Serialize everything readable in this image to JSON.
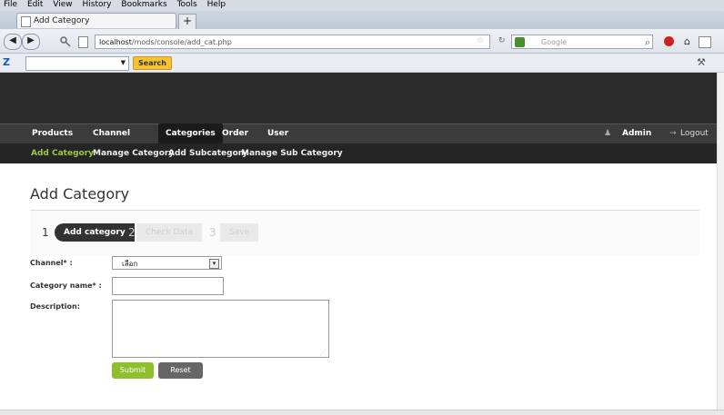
{
  "menubar": [
    "File",
    "Edit",
    "View",
    "History",
    "Bookmarks",
    "Tools",
    "Help"
  ],
  "tab": {
    "title": "Add Category",
    "new_tab": "+"
  },
  "navbar": {
    "back": "◀",
    "forward": "▶",
    "url_host": "localhost",
    "url_path": "/mods/console/add_cat.php",
    "search_engine": "Google"
  },
  "toolbar2": {
    "logo": "Z",
    "search_button": "Search"
  },
  "mainnav": {
    "items": [
      "Products",
      "Channel",
      "Categories",
      "Order",
      "User"
    ],
    "active": "Categories",
    "admin": "Admin",
    "logout": "Logout"
  },
  "subnav": {
    "items": [
      "Add Category",
      "Manage Category",
      "Add Subcategory",
      "Manage Sub Category"
    ],
    "active": "Add Category"
  },
  "page": {
    "title": "Add Category",
    "steps": [
      {
        "num": "1",
        "label": "Add category"
      },
      {
        "num": "2",
        "label": "Check Data"
      },
      {
        "num": "3",
        "label": "Save"
      }
    ],
    "fields": {
      "channel_label": "Channel* :",
      "channel_value": "เลือก",
      "category_label": "Category name* :",
      "description_label": "Description:"
    },
    "buttons": {
      "submit": "Submit",
      "reset": "Reset"
    }
  },
  "colors": {
    "header_dark": "#2c2c2c",
    "accent_green": "#8fbf2b",
    "subnav_active": "#9bcb3a"
  }
}
